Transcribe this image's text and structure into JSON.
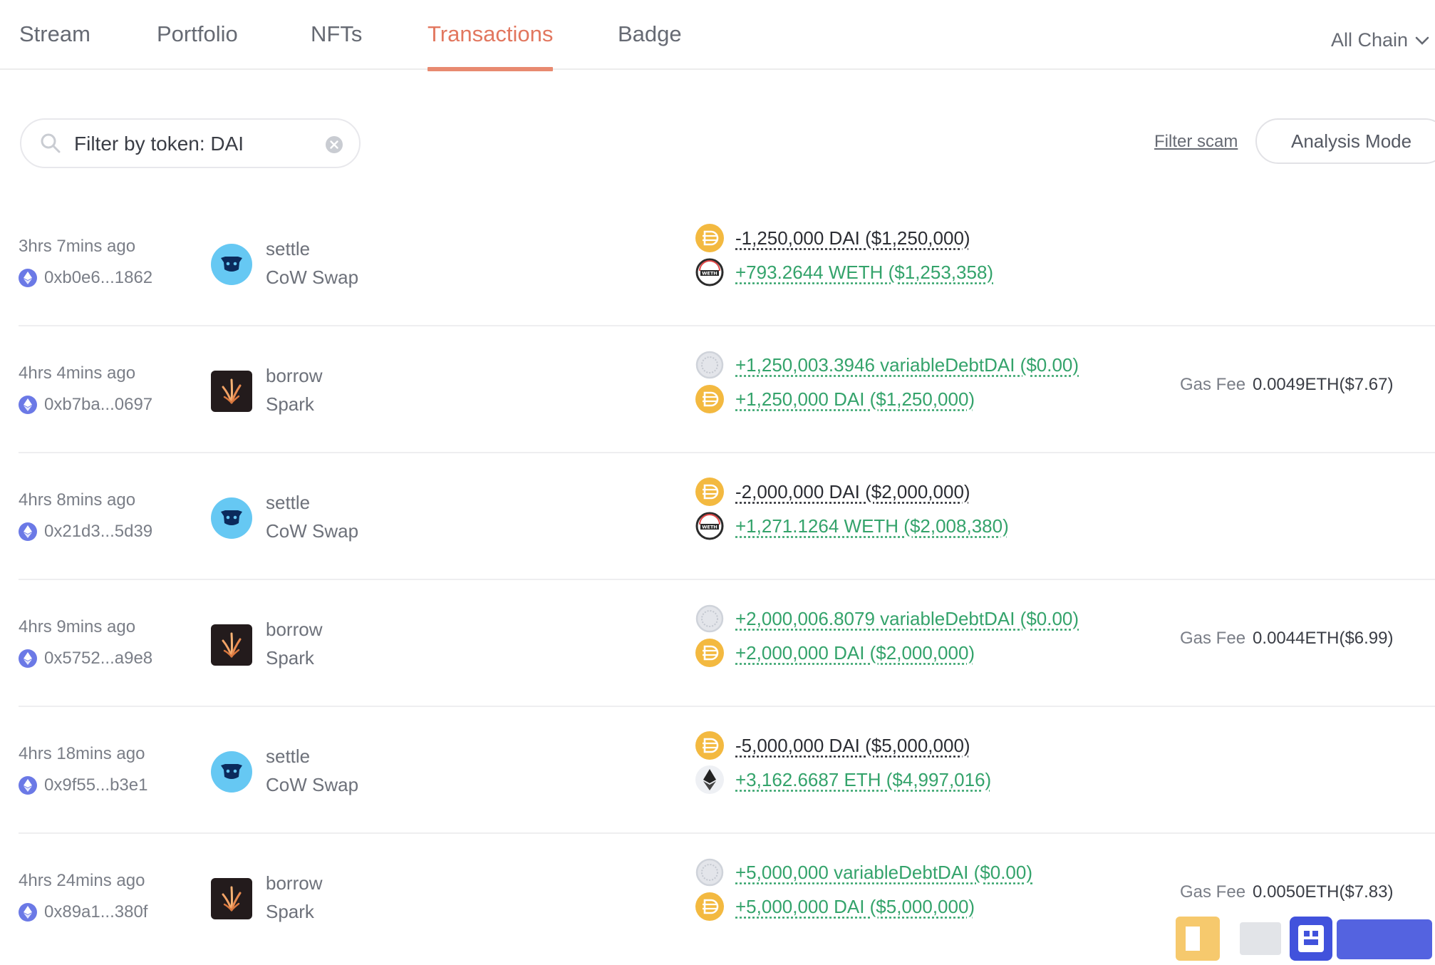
{
  "tabs": [
    {
      "label": "Stream",
      "active": false
    },
    {
      "label": "Portfolio",
      "active": false
    },
    {
      "label": "NFTs",
      "active": false
    },
    {
      "label": "Transactions",
      "active": true
    },
    {
      "label": "Badge",
      "active": false
    }
  ],
  "chain_select": {
    "label": "All Chain"
  },
  "filter": {
    "value": "Filter by token: DAI",
    "filter_scam_label": "Filter scam",
    "analysis_mode_label": "Analysis Mode"
  },
  "colors": {
    "active_tab": "#e2775f",
    "positive_amount": "#34a36b",
    "negative_amount": "#2b2d33",
    "dai": "#f3b940",
    "cow_swap": "#66c8f3",
    "spark": "#231b1c",
    "eth_chain": "#6b79e6"
  },
  "transactions": [
    {
      "time": "3hrs 7mins ago",
      "hash": "0xb0e6...1862",
      "action": "settle",
      "protocol": "CoW Swap",
      "protocol_icon": "cow-swap-icon",
      "tokens": [
        {
          "icon": "dai-icon",
          "amount": "-1,250,000 DAI ($1,250,000)",
          "direction": "out"
        },
        {
          "icon": "weth-icon",
          "amount": "+793.2644 WETH ($1,253,358)",
          "direction": "in"
        }
      ],
      "gas_label": "",
      "gas_value": ""
    },
    {
      "time": "4hrs 4mins ago",
      "hash": "0xb7ba...0697",
      "action": "borrow",
      "protocol": "Spark",
      "protocol_icon": "spark-icon",
      "tokens": [
        {
          "icon": "variable-debt-dai-icon",
          "amount": "+1,250,003.3946 variableDebtDAI ($0.00)",
          "direction": "in"
        },
        {
          "icon": "dai-icon",
          "amount": "+1,250,000 DAI ($1,250,000)",
          "direction": "in"
        }
      ],
      "gas_label": "Gas Fee",
      "gas_value": "0.0049ETH($7.67)"
    },
    {
      "time": "4hrs 8mins ago",
      "hash": "0x21d3...5d39",
      "action": "settle",
      "protocol": "CoW Swap",
      "protocol_icon": "cow-swap-icon",
      "tokens": [
        {
          "icon": "dai-icon",
          "amount": "-2,000,000 DAI ($2,000,000)",
          "direction": "out"
        },
        {
          "icon": "weth-icon",
          "amount": "+1,271.1264 WETH ($2,008,380)",
          "direction": "in"
        }
      ],
      "gas_label": "",
      "gas_value": ""
    },
    {
      "time": "4hrs 9mins ago",
      "hash": "0x5752...a9e8",
      "action": "borrow",
      "protocol": "Spark",
      "protocol_icon": "spark-icon",
      "tokens": [
        {
          "icon": "variable-debt-dai-icon",
          "amount": "+2,000,006.8079 variableDebtDAI ($0.00)",
          "direction": "in"
        },
        {
          "icon": "dai-icon",
          "amount": "+2,000,000 DAI ($2,000,000)",
          "direction": "in"
        }
      ],
      "gas_label": "Gas Fee",
      "gas_value": "0.0044ETH($6.99)"
    },
    {
      "time": "4hrs 18mins ago",
      "hash": "0x9f55...b3e1",
      "action": "settle",
      "protocol": "CoW Swap",
      "protocol_icon": "cow-swap-icon",
      "tokens": [
        {
          "icon": "dai-icon",
          "amount": "-5,000,000 DAI ($5,000,000)",
          "direction": "out"
        },
        {
          "icon": "eth-icon",
          "amount": "+3,162.6687 ETH ($4,997,016)",
          "direction": "in"
        }
      ],
      "gas_label": "",
      "gas_value": ""
    },
    {
      "time": "4hrs 24mins ago",
      "hash": "0x89a1...380f",
      "action": "borrow",
      "protocol": "Spark",
      "protocol_icon": "spark-icon",
      "tokens": [
        {
          "icon": "variable-debt-dai-icon",
          "amount": "+5,000,000 variableDebtDAI ($0.00)",
          "direction": "in"
        },
        {
          "icon": "dai-icon",
          "amount": "+5,000,000 DAI ($5,000,000)",
          "direction": "in"
        }
      ],
      "gas_label": "Gas Fee",
      "gas_value": "0.0050ETH($7.83)"
    }
  ]
}
